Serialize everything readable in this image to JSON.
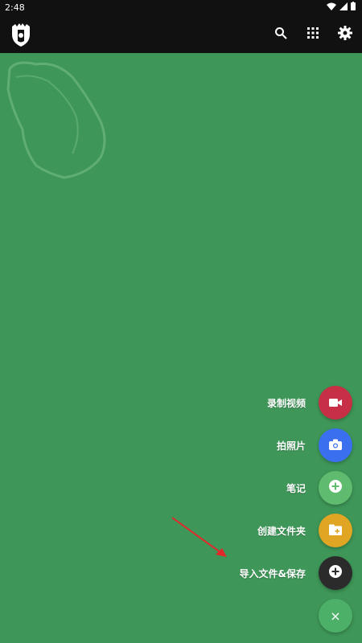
{
  "status_bar": {
    "time": "2:48"
  },
  "app_bar": {
    "logo_icon": "castle-shield-icon",
    "actions": [
      {
        "name": "search",
        "icon": "search-icon"
      },
      {
        "name": "apps",
        "icon": "grid-icon"
      },
      {
        "name": "settings",
        "icon": "gear-icon"
      }
    ]
  },
  "colors": {
    "background": "#3E9758",
    "topbar": "#111111",
    "video": "#C62F46",
    "photo": "#3A6FF0",
    "note": "#5FBB6E",
    "folder": "#E0A523",
    "import": "#2B2B2B",
    "close": "#4DB068"
  },
  "fab_menu": {
    "items": [
      {
        "label": "录制视频",
        "icon": "video-camera-icon"
      },
      {
        "label": "拍照片",
        "icon": "camera-icon"
      },
      {
        "label": "笔记",
        "icon": "add-circle-icon"
      },
      {
        "label": "创建文件夹",
        "icon": "folder-add-icon"
      },
      {
        "label": "导入文件&保存",
        "icon": "add-circle-icon"
      }
    ],
    "close_label": "×"
  }
}
